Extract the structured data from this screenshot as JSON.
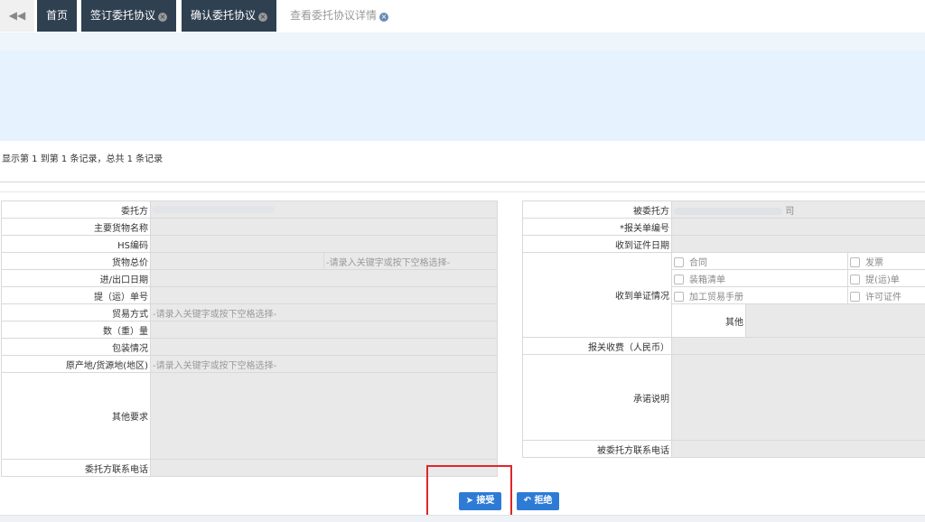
{
  "tabs": {
    "back_icon": "◀◀",
    "home": "首页",
    "tab1": "签订委托协议",
    "tab2": "确认委托协议",
    "tab3": "查看委托协议详情",
    "close_icon": "×"
  },
  "records_text": "显示第 1 到第 1 条记录，总共 1 条记录",
  "left_form": {
    "consignor": "委托方",
    "goods_name": "主要货物名称",
    "hs_code": "HS编码",
    "total_price": "货物总价",
    "price_placeholder": "-请录入关键字或按下空格选择-",
    "io_date": "进/出口日期",
    "bill_no": "提（运）单号",
    "trade_mode": "贸易方式",
    "trade_placeholder": "-请录入关键字或按下空格选择-",
    "quantity": "数（重）量",
    "packing": "包装情况",
    "origin": "原产地/货源地(地区)",
    "origin_placeholder": "-请录入关键字或按下空格选择-",
    "other_req": "其他要求",
    "consignor_phone": "委托方联系电话"
  },
  "right_form": {
    "consignee": "被委托方",
    "consignee_value_partial": "司",
    "decl_no": "*报关单编号",
    "doc_date": "收到证件日期",
    "doc_status": "收到单证情况",
    "contract": "合同",
    "invoice": "发票",
    "packing_list": "装箱清单",
    "bill": "提(运)单",
    "processing_manual": "加工贸易手册",
    "license": "许可证件",
    "other": "其他",
    "fee": "报关收费（人民币）",
    "commitment": "承诺说明",
    "consignee_phone": "被委托方联系电话"
  },
  "buttons": {
    "accept": "接受",
    "accept_icon": "➤",
    "reject": "拒绝",
    "reject_icon": "↶"
  },
  "colors": {
    "tab_dark": "#2f4050",
    "button_blue": "#2e7bd6",
    "highlight_red": "#e0262b",
    "readonly_gray": "#e9e9e9"
  }
}
